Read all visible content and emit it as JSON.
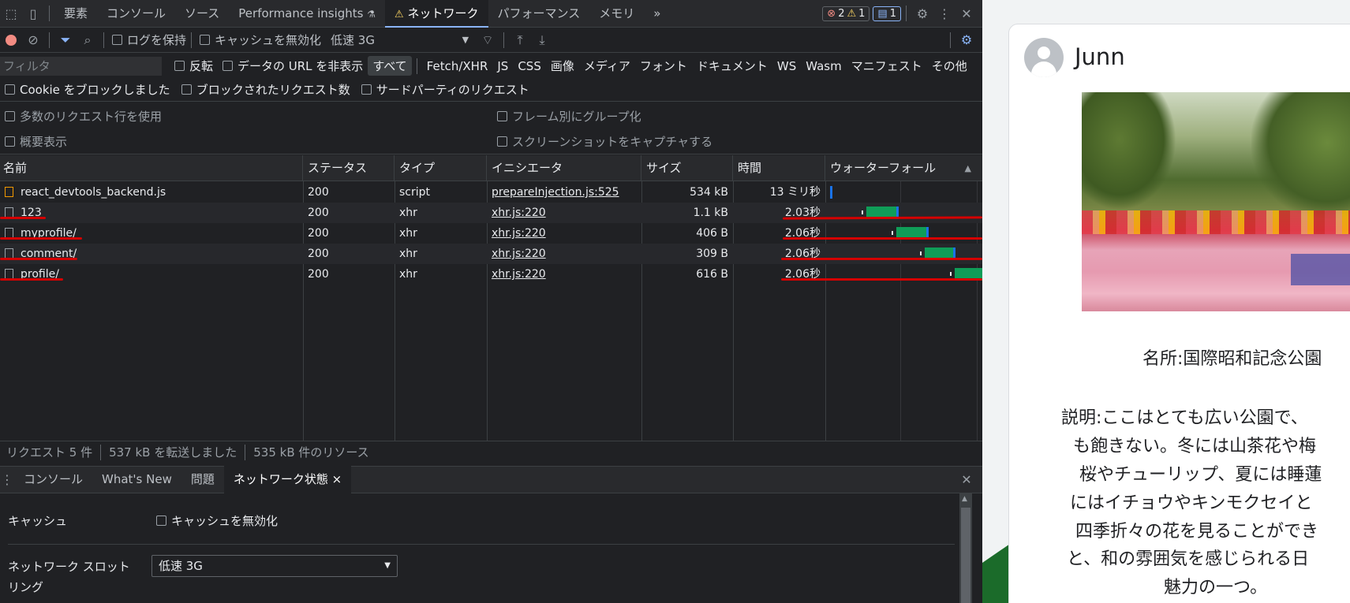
{
  "tabs": {
    "elements": "要素",
    "console": "コンソール",
    "sources": "ソース",
    "perf_insights": "Performance insights",
    "network": "ネットワーク",
    "performance": "パフォーマンス",
    "memory": "メモリ",
    "more": "»"
  },
  "badges": {
    "errors": "2",
    "warnings": "1",
    "messages": "1"
  },
  "toolbar": {
    "preserve_log": "ログを保持",
    "disable_cache": "キャッシュを無効化",
    "throttle": "低速 3G"
  },
  "filter": {
    "placeholder": "フィルタ",
    "invert": "反転",
    "hide_data_urls": "データの URL を非表示",
    "types": [
      "すべて",
      "Fetch/XHR",
      "JS",
      "CSS",
      "画像",
      "メディア",
      "フォント",
      "ドキュメント",
      "WS",
      "Wasm",
      "マニフェスト",
      "その他"
    ]
  },
  "row3": {
    "blocked_cookies": "Cookie をブロックしました",
    "blocked_requests": "ブロックされたリクエスト数",
    "third_party": "サードパーティのリクエスト"
  },
  "settings": {
    "big_rows": "多数のリクエスト行を使用",
    "group_by_frame": "フレーム別にグループ化",
    "overview": "概要表示",
    "screenshots": "スクリーンショットをキャプチャする"
  },
  "columns": {
    "name": "名前",
    "status": "ステータス",
    "type": "タイプ",
    "initiator": "イニシエータ",
    "size": "サイズ",
    "time": "時間",
    "waterfall": "ウォーターフォール"
  },
  "requests": [
    {
      "name": "react_devtools_backend.js",
      "status": "200",
      "type": "script",
      "initiator": "prepareInjection.js:525",
      "size": "534 kB",
      "time": "13 ミリ秒"
    },
    {
      "name": "123",
      "status": "200",
      "type": "xhr",
      "initiator": "xhr.js:220",
      "size": "1.1 kB",
      "time": "2.03秒"
    },
    {
      "name": "myprofile/",
      "status": "200",
      "type": "xhr",
      "initiator": "xhr.js:220",
      "size": "406 B",
      "time": "2.06秒"
    },
    {
      "name": "comment/",
      "status": "200",
      "type": "xhr",
      "initiator": "xhr.js:220",
      "size": "309 B",
      "time": "2.06秒"
    },
    {
      "name": "profile/",
      "status": "200",
      "type": "xhr",
      "initiator": "xhr.js:220",
      "size": "616 B",
      "time": "2.06秒"
    }
  ],
  "status_bar": {
    "requests": "リクエスト 5 件",
    "transferred": "537 kB を転送しました",
    "resources": "535 kB 件のリソース"
  },
  "drawer": {
    "tabs": [
      "コンソール",
      "What's New",
      "問題",
      "ネットワーク状態"
    ],
    "close": "×",
    "cache_label": "キャッシュ",
    "disable_cache": "キャッシュを無効化",
    "throttling_label_1": "ネットワーク スロット",
    "throttling_label_2": "リング",
    "throttling_value": "低速 3G"
  },
  "page": {
    "user": "Junn",
    "place": "名所:国際昭和記念公園",
    "desc": [
      "説明:ここはとても広い公園で、",
      "も飽きない。冬には山茶花や梅",
      "桜やチューリップ、夏には睡蓮",
      "にはイチョウやキンモクセイと",
      "四季折々の花を見ることができ",
      "と、和の雰囲気を感じられる日",
      "魅力の一つ。"
    ]
  },
  "colors": {
    "accent": "#8ab4f8",
    "success": "#0f9d58",
    "annotation": "#d50000"
  }
}
